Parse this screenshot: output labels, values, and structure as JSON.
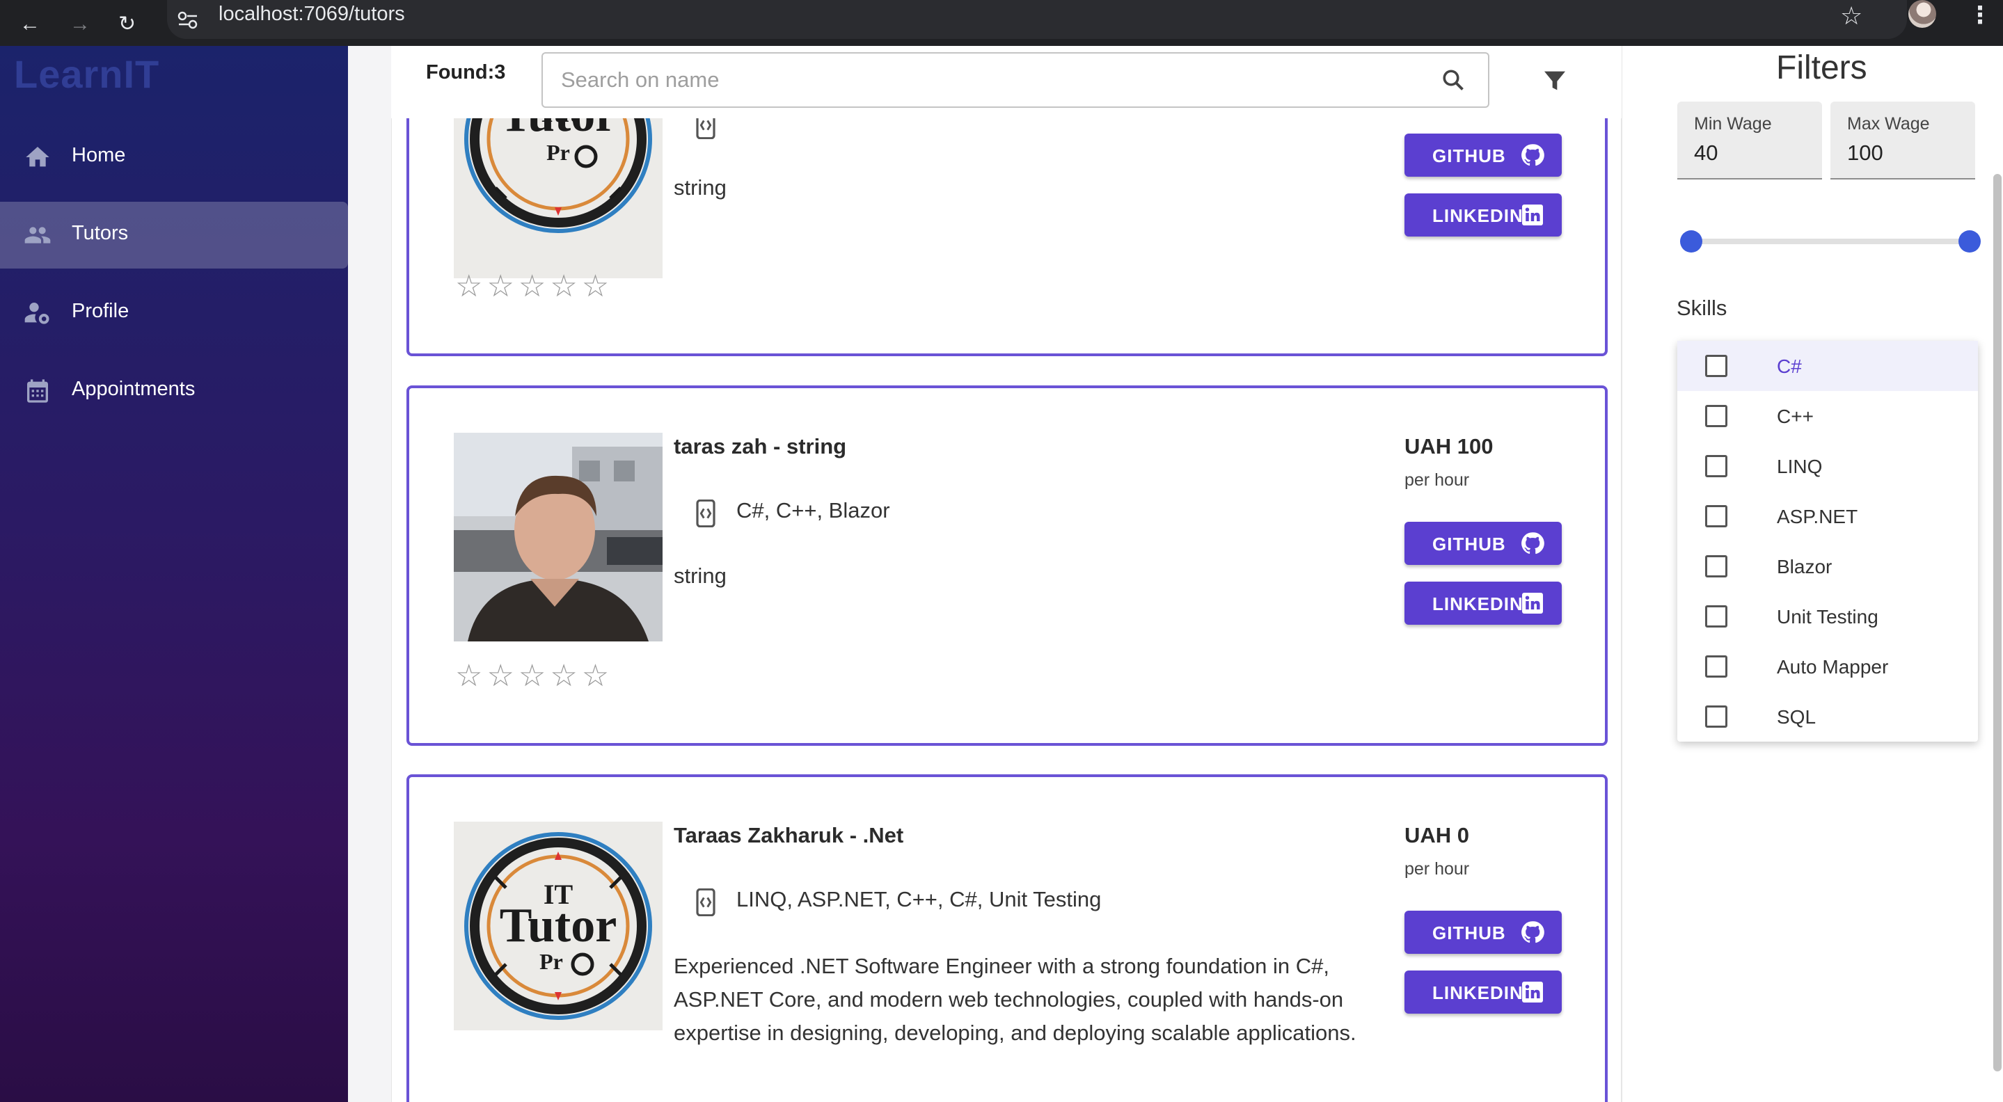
{
  "browser": {
    "url": "localhost:7069/tutors"
  },
  "app": {
    "logo": "LearnIT"
  },
  "sidebar": {
    "items": [
      {
        "label": "Home",
        "icon": "home-icon"
      },
      {
        "label": "Tutors",
        "icon": "people-icon",
        "active": true
      },
      {
        "label": "Profile",
        "icon": "person-gear-icon"
      },
      {
        "label": "Appointments",
        "icon": "calendar-icon"
      }
    ]
  },
  "toolbar": {
    "found_label": "Found:3",
    "search_placeholder": "Search on name"
  },
  "tutors": [
    {
      "name": "",
      "skills": "",
      "description": "string",
      "price": "",
      "per": "",
      "github_label": "GITHUB",
      "linkedin_label": "LINKEDIN",
      "rating": 0,
      "max_rating": 5,
      "photo": "it-tutor-pro-logo"
    },
    {
      "name": "taras zah - string",
      "skills": "C#, C++, Blazor",
      "description": "string",
      "price": "UAH 100",
      "per": "per hour",
      "github_label": "GITHUB",
      "linkedin_label": "LINKEDIN",
      "rating": 0,
      "max_rating": 5,
      "photo": "person-photo"
    },
    {
      "name": "Taraas Zakharuk - .Net",
      "skills": "LINQ, ASP.NET, C++, C#, Unit Testing",
      "description": "Experienced .NET Software Engineer with a strong foundation in C#, ASP.NET Core, and modern web technologies, coupled with hands-on expertise in designing, developing, and deploying scalable applications.",
      "price": "UAH 0",
      "per": "per hour",
      "github_label": "GITHUB",
      "linkedin_label": "LINKEDIN",
      "rating": 0,
      "max_rating": 5,
      "photo": "it-tutor-pro-logo"
    }
  ],
  "filters": {
    "title": "Filters",
    "min_wage_label": "Min Wage",
    "min_wage_value": "40",
    "max_wage_label": "Max Wage",
    "max_wage_value": "100",
    "skills_label": "Skills",
    "skills": [
      "C#",
      "C++",
      "LINQ",
      "ASP.NET",
      "Blazor",
      "Unit Testing",
      "Auto Mapper",
      "SQL"
    ]
  },
  "colors": {
    "accent": "#5b3fd0",
    "card_border": "#6a53d6",
    "slider": "#3b5bdb"
  }
}
